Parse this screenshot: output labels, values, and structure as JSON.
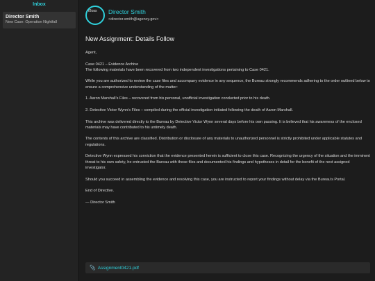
{
  "sidebar": {
    "title": "Inbox",
    "items": [
      {
        "sender": "Director Smith",
        "subject": "New Case: Operation Nightfall"
      }
    ]
  },
  "email": {
    "avatar_text": "IBoss",
    "sender_name": "Director Smith",
    "sender_email": "<director.smith@agency.gov>",
    "subject": "New Assignment: Details Follow",
    "paragraphs": [
      "Agent,",
      "Case 0421 – Evidence Archive",
      "The following materials have been recovered from two independent investigations pertaining to Case 0421.",
      "While you are authorized to review the case files and accompany evidence in any sequence, the Bureau strongly recommends adhering to the order outlined below to ensure a comprehensive understanding of the matter:",
      "1. Aaron Marshall’s Files – recovered from his personal, unofficial investigation conducted prior to his death.",
      "2. Detective Victor Wynn’s Files – compiled during the official investigation initiated following the death of Aaron Marshall.",
      "This archive was delivered directly to the Bureau by Detective Victor Wynn several days before his own passing. It is believed that his awareness of the enclosed materials may have contributed to his untimely death.",
      "The contents of this archive are classified. Distribution or disclosure of any materials to unauthorized personnel is strictly prohibited under applicable statutes and regulations.",
      "Detective Wynn expressed his conviction that the evidence presented herein is sufficient to close this case. Recognizing the urgency of the situation and the imminent threat to his own safety, he entrusted the Bureau with these files and documented his findings and hypotheses in detail for the benefit of the next assigned investigator.",
      "Should you succeed in assembling the evidence and resolving this case, you are instructed to report your findings without delay via the Bureau’s Portal.",
      "End of Directive.",
      "— Director Smith"
    ],
    "attachment": {
      "icon": "paperclip-icon",
      "name": "Assignment0421.pdf"
    }
  },
  "colors": {
    "accent": "#2fd1dc",
    "background": "#1c1c1c",
    "sidebar": "#232323"
  }
}
